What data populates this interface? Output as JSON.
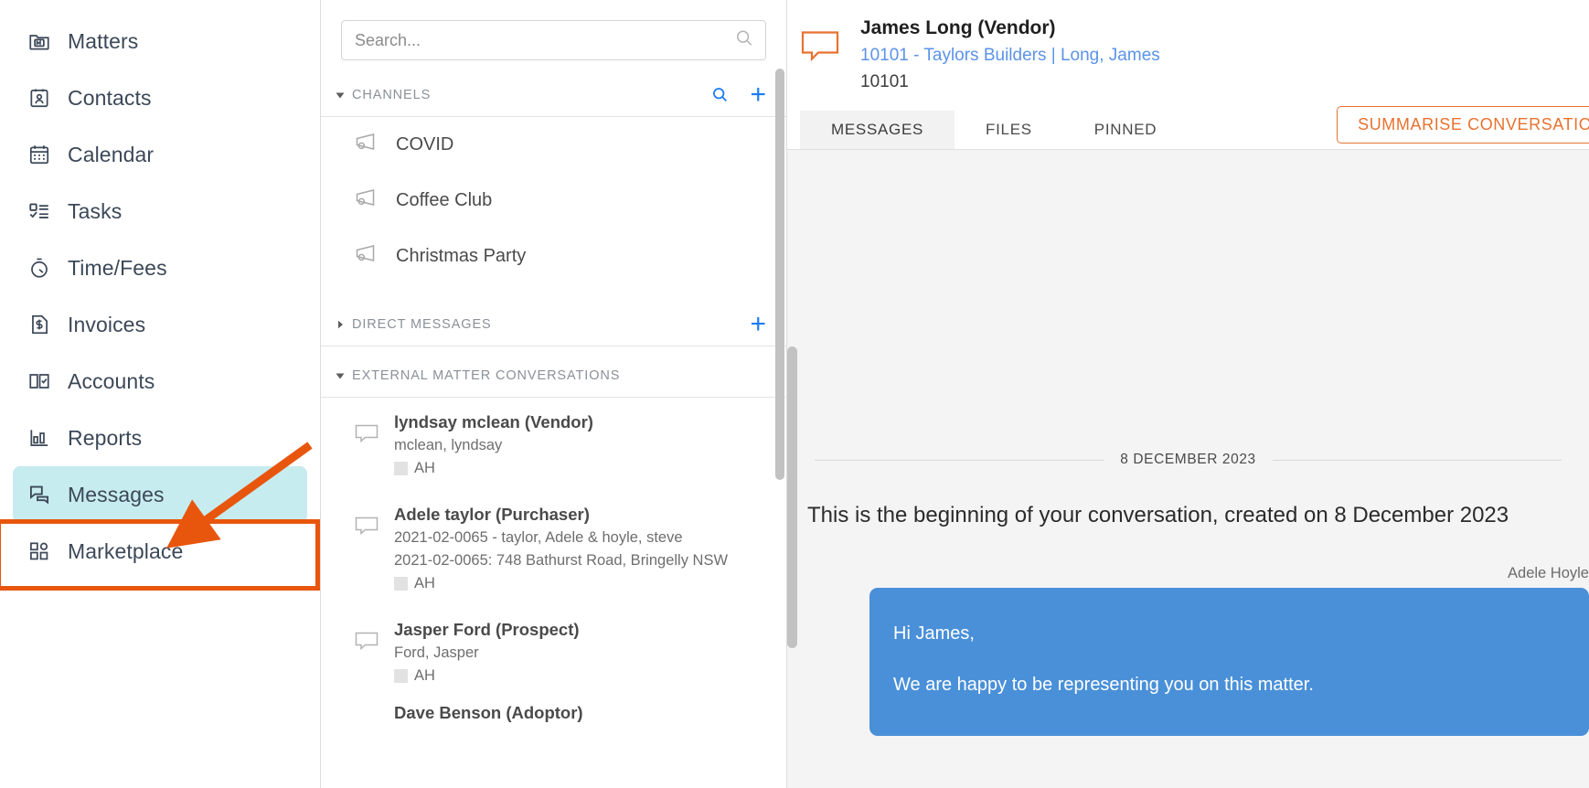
{
  "sidebar": {
    "items": [
      {
        "label": "Matters",
        "icon": "folder-m-icon",
        "active": false
      },
      {
        "label": "Contacts",
        "icon": "contact-card-icon",
        "active": false
      },
      {
        "label": "Calendar",
        "icon": "calendar-icon",
        "active": false
      },
      {
        "label": "Tasks",
        "icon": "task-list-icon",
        "active": false
      },
      {
        "label": "Time/Fees",
        "icon": "stopwatch-icon",
        "active": false
      },
      {
        "label": "Invoices",
        "icon": "invoice-icon",
        "active": false
      },
      {
        "label": "Accounts",
        "icon": "ledger-book-icon",
        "active": false
      },
      {
        "label": "Reports",
        "icon": "bar-chart-icon",
        "active": false
      },
      {
        "label": "Messages",
        "icon": "chat-bubbles-icon",
        "active": true
      },
      {
        "label": "Marketplace",
        "icon": "grid-apps-icon",
        "active": false
      }
    ],
    "highlight_color": "#e8560d",
    "active_bg": "#c7ecef"
  },
  "middle": {
    "search": {
      "placeholder": "Search...",
      "value": "",
      "icon": "search-icon"
    },
    "sections": [
      {
        "title": "CHANNELS",
        "expanded": true,
        "caret": "caret-down-icon",
        "actions": [
          "search-icon",
          "plus-icon"
        ],
        "items": [
          {
            "label": "COVID",
            "icon": "megaphone-icon"
          },
          {
            "label": "Coffee Club",
            "icon": "megaphone-icon"
          },
          {
            "label": "Christmas Party",
            "icon": "megaphone-icon"
          }
        ]
      },
      {
        "title": "DIRECT MESSAGES",
        "expanded": false,
        "caret": "caret-right-icon",
        "actions": [
          "plus-icon"
        ],
        "items": []
      },
      {
        "title": "EXTERNAL MATTER CONVERSATIONS",
        "expanded": true,
        "caret": "caret-down-icon",
        "actions": [],
        "items": []
      }
    ],
    "conversations": [
      {
        "title": "lyndsay mclean (Vendor)",
        "lines": [
          "mclean, lyndsay"
        ],
        "tag": "AH",
        "icon": "chat-bubble-icon"
      },
      {
        "title": "Adele taylor (Purchaser)",
        "lines": [
          "2021-02-0065 - taylor, Adele & hoyle, steve",
          "2021-02-0065: 748 Bathurst Road, Bringelly NSW"
        ],
        "tag": "AH",
        "icon": "chat-bubble-icon"
      },
      {
        "title": "Jasper Ford (Prospect)",
        "lines": [
          "Ford, Jasper"
        ],
        "tag": "AH",
        "icon": "chat-bubble-icon"
      },
      {
        "title": "Dave Benson (Adoptor)",
        "lines": [],
        "tag": "",
        "icon": "chat-bubble-icon"
      }
    ]
  },
  "conversation": {
    "icon": "chat-bubble-orange-icon",
    "name": "James Long (Vendor)",
    "matter_link": "10101 - Taylors Builders | Long, James",
    "matter_id": "10101",
    "tabs": [
      {
        "label": "MESSAGES",
        "active": true
      },
      {
        "label": "FILES",
        "active": false
      },
      {
        "label": "PINNED",
        "active": false
      }
    ],
    "summarise_button": "SUMMARISE CONVERSATION",
    "date_separator": "8 DECEMBER 2023",
    "beginning_text": "This is the beginning of your conversation, created on 8 December 2023",
    "messages": [
      {
        "sender": "Adele Hoyle",
        "lines": [
          "Hi James,",
          "",
          "We are happy to be representing you on this matter."
        ],
        "outgoing": true,
        "bubble_color": "#4a90d9"
      }
    ]
  }
}
